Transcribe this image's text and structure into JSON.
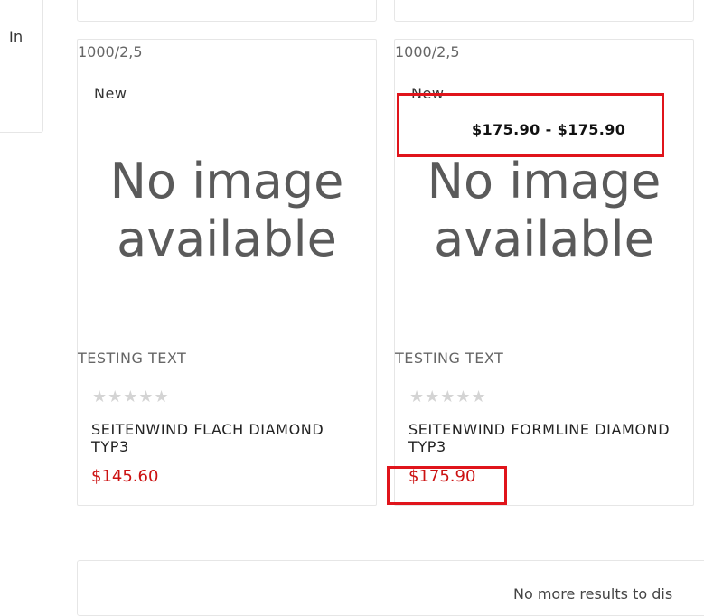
{
  "sidebar": {
    "partial_text": "In"
  },
  "products": [
    {
      "sku": "1000/2,5",
      "badge": "New",
      "image_alt": "No image available",
      "image_line1": "No image",
      "image_line2": "available",
      "note": "TESTING TEXT",
      "stars": "★★★★★",
      "rating": 0,
      "name": "SEITENWIND FLACH DIAMOND TYP3",
      "price": "$145.60"
    },
    {
      "sku": "1000/2,5",
      "badge": "New",
      "image_alt": "No image available",
      "image_line1": "No image",
      "image_line2": "available",
      "note": "TESTING TEXT",
      "stars": "★★★★★",
      "rating": 0,
      "name": "SEITENWIND FORMLINE DIAMOND TYP3",
      "price": "$175.90",
      "price_range": "$175.90 - $175.90"
    }
  ],
  "footer": {
    "message": "No more results to dis"
  },
  "colors": {
    "price": "#cc1212",
    "highlight": "#e0141b",
    "star_empty": "#d4d4d4",
    "border": "#e6e6e6"
  }
}
